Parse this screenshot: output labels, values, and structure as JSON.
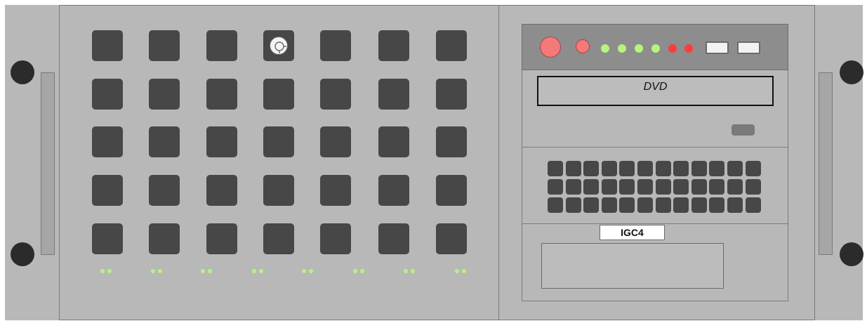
{
  "dvd_label": "DVD",
  "unit_label": "IGC4",
  "colors": {
    "chassis": "#b8b8b8",
    "bay": "#474747",
    "led_green": "#b4f57e",
    "led_red": "#ff3b3b",
    "button_red": "#f47a7a"
  },
  "icons": {
    "power": "power-icon",
    "screw": "screw-icon"
  }
}
